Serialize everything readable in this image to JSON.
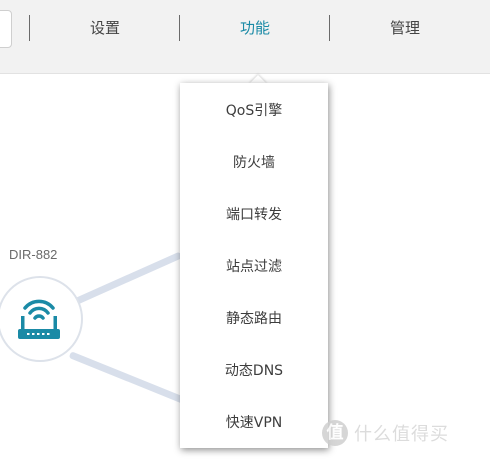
{
  "nav": {
    "items": [
      {
        "label": "设置"
      },
      {
        "label": "功能"
      },
      {
        "label": "管理"
      }
    ],
    "active": "功能"
  },
  "device": {
    "name": "DIR-882",
    "icon": "router-icon"
  },
  "menu": {
    "items": [
      {
        "label": "QoS引擎"
      },
      {
        "label": "防火墙"
      },
      {
        "label": "端口转发"
      },
      {
        "label": "站点过滤"
      },
      {
        "label": "静态路由"
      },
      {
        "label": "动态DNS"
      },
      {
        "label": "快速VPN"
      }
    ]
  },
  "watermark": {
    "logo": "值",
    "text": "什么值得买"
  },
  "colors": {
    "accent": "#1a8aa6",
    "nav_bg": "#f2f2f2",
    "connector": "#d8dfeb"
  }
}
